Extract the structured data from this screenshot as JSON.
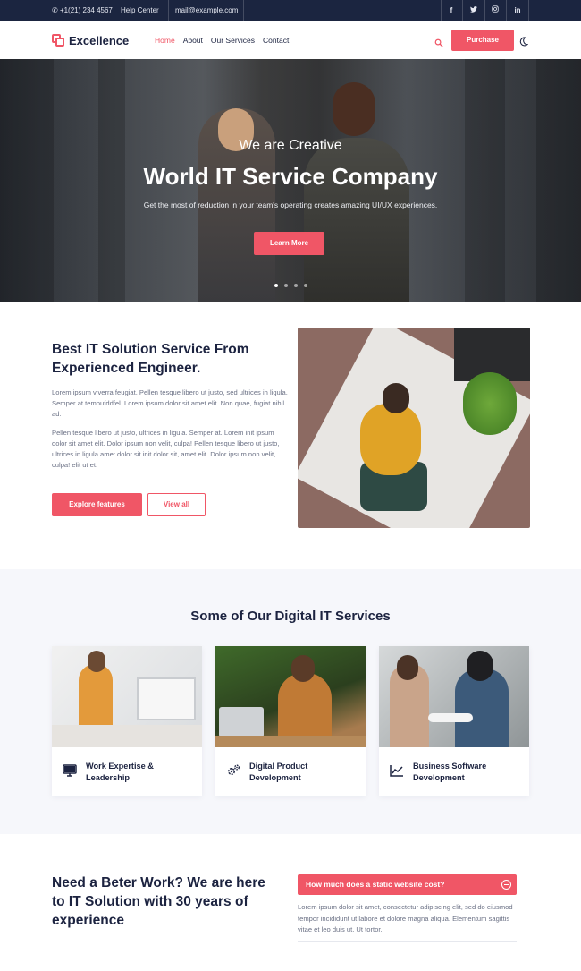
{
  "topbar": {
    "phone": "+1(21) 234 4567",
    "help": "Help Center",
    "email": "mail@example.com",
    "social": [
      {
        "icon": "facebook-icon",
        "glyph": "f"
      },
      {
        "icon": "twitter-icon",
        "glyph": "t"
      },
      {
        "icon": "instagram-icon",
        "glyph": "◎"
      },
      {
        "icon": "linkedin-icon",
        "glyph": "in"
      }
    ]
  },
  "nav": {
    "brand": "Excellence",
    "menu": [
      "Home",
      "About",
      "Our Services",
      "Contact"
    ],
    "active_item": "Home",
    "purchase_label": "Purchase"
  },
  "hero": {
    "eyebrow": "We are Creative",
    "title": "World IT Service Company",
    "subtitle": "Get the most of reduction in your team's operating creates amazing UI/UX experiences.",
    "cta": "Learn More",
    "slides": 4,
    "active_slide": 1
  },
  "about": {
    "title": "Best IT Solution Service From Experienced Engineer.",
    "paragraph1": "Lorem ipsum viverra feugiat. Pellen tesque libero ut justo, sed ultrices in ligula. Semper at tempufddfel. Lorem ipsum dolor sit amet elit. Non quae, fugiat nihil ad.",
    "paragraph2": "Pellen tesque libero ut justo, ultrices in ligula. Semper at. Lorem init ipsum dolor sit amet elit. Dolor ipsum non velit, culpa! Pellen tesque libero ut justo, ultrices in ligula amet dolor sit init dolor sit, amet elit. Dolor ipsum non velit, culpa! elit ut et.",
    "explore_label": "Explore features",
    "viewall_label": "View all"
  },
  "services": {
    "title": "Some of Our Digital IT Services",
    "items": [
      {
        "label": "Work Expertise & Leadership",
        "icon": "monitor-icon"
      },
      {
        "label": "Digital Product Development",
        "icon": "gears-icon"
      },
      {
        "label": "Business Software Development",
        "icon": "chart-line-icon"
      }
    ]
  },
  "faq": {
    "title": "Need a Beter Work? We are here to IT Solution with 30 years of experience",
    "question": "How much does a static website cost?",
    "answer": "Lorem ipsum dolor sit amet, consectetur adipiscing elit, sed do eiusmod tempor incididunt ut labore et dolore magna aliqua. Elementum sagittis vitae et leo duis ut. Ut tortor."
  },
  "colors": {
    "accent": "#f05666",
    "topbar": "#1b2540",
    "heading": "#1c2340",
    "body_text": "#6b7185",
    "section_bg": "#f6f7fb"
  }
}
